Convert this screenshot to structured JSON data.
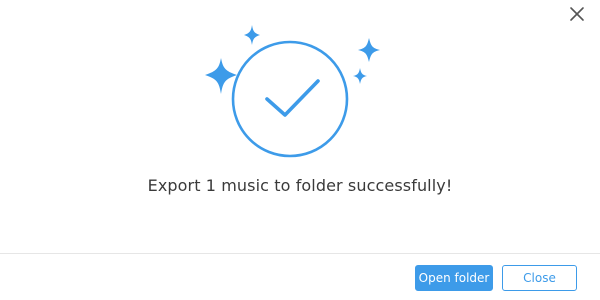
{
  "dialog": {
    "message": "Export 1 music to folder successfully!",
    "close_icon": "close-x-icon",
    "illustration_icon": "success-check-sparkles-icon",
    "accent_color": "#3d9be9"
  },
  "footer": {
    "open_folder_label": "Open folder",
    "close_label": "Close"
  }
}
